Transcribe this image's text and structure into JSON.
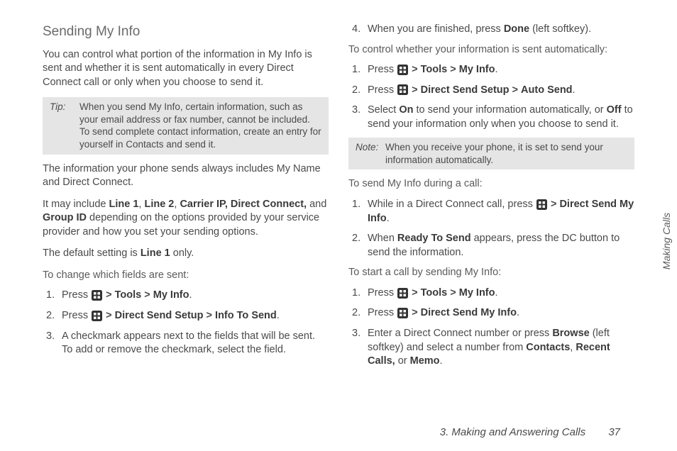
{
  "heading": "Sending My Info",
  "left": {
    "intro": "You can control what portion of the information in My Info is sent and whether it is sent automatically in every Direct Connect call or only when you choose to send it.",
    "tip_label": "Tip:",
    "tip_text": "When you send My Info, certain information, such as your email address or fax number, cannot be included. To send complete contact information, create an entry for yourself in Contacts and send it.",
    "para2": "The information your phone sends always includes My Name and Direct Connect.",
    "para3_a": "It may include ",
    "para3_line1": "Line 1",
    "para3_comma1": ", ",
    "para3_line2": "Line 2",
    "para3_comma2": ", ",
    "para3_carrier": "Carrier IP, Direct Connect,",
    "para3_b": " and ",
    "para3_group": "Group ID",
    "para3_c": " depending on the options provided by your service provider and how you set your sending options.",
    "para4_a": "The default setting is ",
    "para4_line1": "Line 1",
    "para4_b": " only.",
    "sub1": "To change which fields are sent:",
    "list1": {
      "i1_a": "Press ",
      "i1_tools": "Tools",
      "i1_myinfo": "My Info",
      "i2_a": "Press ",
      "i2_dss": "Direct Send Setup",
      "i2_its": "Info To Send",
      "i3": "A checkmark appears next to the fields that will be sent. To add or remove the checkmark, select the field."
    }
  },
  "right": {
    "i4_a": "When you are finished, press ",
    "i4_done": "Done",
    "i4_b": " (left softkey).",
    "sub2": "To control whether your information is sent automatically:",
    "list2": {
      "i1_a": "Press ",
      "i1_tools": "Tools",
      "i1_myinfo": "My Info",
      "i2_a": "Press ",
      "i2_dss": "Direct Send Setup",
      "i2_auto": "Auto Send",
      "i3_a": "Select ",
      "i3_on": "On",
      "i3_b": " to send your information automatically, or ",
      "i3_off": "Off",
      "i3_c": " to send your information only when you choose to send it."
    },
    "note_label": "Note:",
    "note_text": "When you receive your phone, it is set to send your information automatically.",
    "sub3": "To send My Info during a call:",
    "list3": {
      "i1_a": "While in a Direct Connect call, press ",
      "i1_dsmi": "Direct Send My Info",
      "i2_a": "When ",
      "i2_rts": "Ready To Send",
      "i2_b": " appears, press the DC button to send the information."
    },
    "sub4": "To start a call by sending My Info:",
    "list4": {
      "i1_a": "Press ",
      "i1_tools": "Tools",
      "i1_myinfo": "My Info",
      "i2_a": "Press ",
      "i2_dsmi": "Direct Send My Info",
      "i3_a": "Enter a Direct Connect number or press ",
      "i3_browse": "Browse",
      "i3_b": " (left softkey) and select a number from ",
      "i3_contacts": "Contacts",
      "i3_c": ", ",
      "i3_recent": "Recent Calls,",
      "i3_d": " or ",
      "i3_memo": "Memo",
      "i3_e": "."
    }
  },
  "side_tab": "Making Calls",
  "footer_chapter": "3. Making and Answering Calls",
  "footer_page": "37",
  "gt": ">",
  "period": "."
}
